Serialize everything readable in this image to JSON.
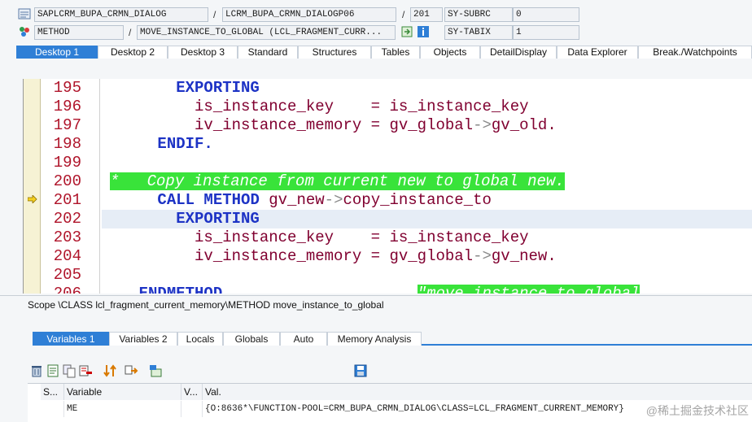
{
  "header": {
    "program": "SAPLCRM_BUPA_CRMN_DIALOG",
    "include": "LCRM_BUPA_CRMN_DIALOGP06",
    "line": "201",
    "sy_subrc_label": "SY-SUBRC",
    "sy_subrc_value": "0",
    "event_type": "METHOD",
    "event": "MOVE_INSTANCE_TO_GLOBAL (LCL_FRAGMENT_CURR...",
    "sy_tabix_label": "SY-TABIX",
    "sy_tabix_value": "1",
    "slash": "/"
  },
  "desktop_tabs": [
    "Desktop 1",
    "Desktop 2",
    "Desktop 3",
    "Standard",
    "Structures",
    "Tables",
    "Objects",
    "DetailDisplay",
    "Data Explorer",
    "Break./Watchpoints"
  ],
  "editor": {
    "line_numbers": [
      "195",
      "196",
      "197",
      "198",
      "199",
      "200",
      "201",
      "202",
      "203",
      "204",
      "205",
      "206"
    ],
    "lines": [
      [
        {
          "t": "        "
        },
        {
          "c": "kw",
          "t": "EXPORTING"
        }
      ],
      [
        {
          "t": "          "
        },
        {
          "c": "id",
          "t": "is_instance_key"
        },
        {
          "t": "    "
        },
        {
          "c": "id",
          "t": "= is_instance_key"
        }
      ],
      [
        {
          "t": "          "
        },
        {
          "c": "id",
          "t": "iv_instance_memory = gv_global"
        },
        {
          "c": "op",
          "t": "->"
        },
        {
          "c": "id",
          "t": "gv_old."
        }
      ],
      [
        {
          "t": "      "
        },
        {
          "c": "kw",
          "t": "ENDIF."
        }
      ],
      [
        {
          "t": ""
        }
      ],
      [
        {
          "c": "cm",
          "t": "*   Copy instance from current new to global new."
        }
      ],
      [
        {
          "t": "      "
        },
        {
          "c": "kw",
          "t": "CALL METHOD"
        },
        {
          "t": " "
        },
        {
          "c": "id",
          "t": "gv_new"
        },
        {
          "c": "op",
          "t": "->"
        },
        {
          "c": "id",
          "t": "copy_instance_to"
        }
      ],
      [
        {
          "t": "        "
        },
        {
          "c": "kw",
          "t": "EXPORTING"
        }
      ],
      [
        {
          "t": "          "
        },
        {
          "c": "id",
          "t": "is_instance_key"
        },
        {
          "t": "    "
        },
        {
          "c": "id",
          "t": "= is_instance_key"
        }
      ],
      [
        {
          "t": "          "
        },
        {
          "c": "id",
          "t": "iv_instance_memory = gv_global"
        },
        {
          "c": "op",
          "t": "->"
        },
        {
          "c": "id",
          "t": "gv_new."
        }
      ],
      [
        {
          "t": ""
        }
      ],
      [
        {
          "t": "    "
        },
        {
          "c": "kw",
          "t": "ENDMETHOD."
        },
        {
          "t": "                    "
        },
        {
          "c": "cm",
          "t": "\"move_instance_to_global"
        }
      ]
    ]
  },
  "scope": "Scope \\CLASS lcl_fragment_current_memory\\METHOD move_instance_to_global",
  "variable_tabs": [
    "Variables 1",
    "Variables 2",
    "Locals",
    "Globals",
    "Auto",
    "Memory Analysis"
  ],
  "grid": {
    "headers": [
      "S...",
      "Variable",
      "V...",
      "Val."
    ],
    "row": {
      "s": "",
      "variable": "ME",
      "v": "",
      "value": "{O:8636*\\FUNCTION-POOL=CRM_BUPA_CRMN_DIALOG\\CLASS=LCL_FRAGMENT_CURRENT_MEMORY}"
    }
  },
  "watermark": "@稀土掘金技术社区",
  "colors": {
    "accent": "#2f7fd6",
    "keyword": "#1d33c5",
    "identifier": "#800030",
    "comment_bg": "#39e33a",
    "line_number": "#b0152b"
  }
}
